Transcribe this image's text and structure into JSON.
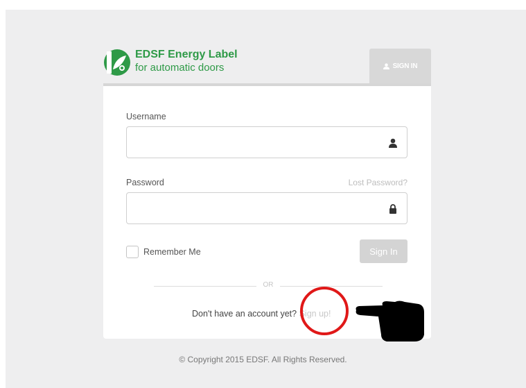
{
  "brand": {
    "line1": "EDSF Energy Label",
    "line2": "for automatic doors",
    "logo_icon": "edsf-leaf-logo",
    "color": "#2e9a47"
  },
  "tab": {
    "label": "SIGN IN",
    "icon": "user-icon"
  },
  "form": {
    "username_label": "Username",
    "username_value": "",
    "username_icon": "user-icon",
    "password_label": "Password",
    "password_value": "",
    "password_icon": "lock-icon",
    "lost_password": "Lost Password?",
    "remember_label": "Remember Me",
    "remember_checked": false,
    "submit_label": "Sign In"
  },
  "divider": {
    "text": "OR"
  },
  "signup": {
    "prompt": "Don't have an account yet?",
    "link_label": "Sign up!"
  },
  "footer": {
    "text": "© Copyright 2015 EDSF. All Rights Reserved."
  },
  "annotations": {
    "circle_color": "#e01818",
    "pointer": "pointing-hand-icon"
  }
}
